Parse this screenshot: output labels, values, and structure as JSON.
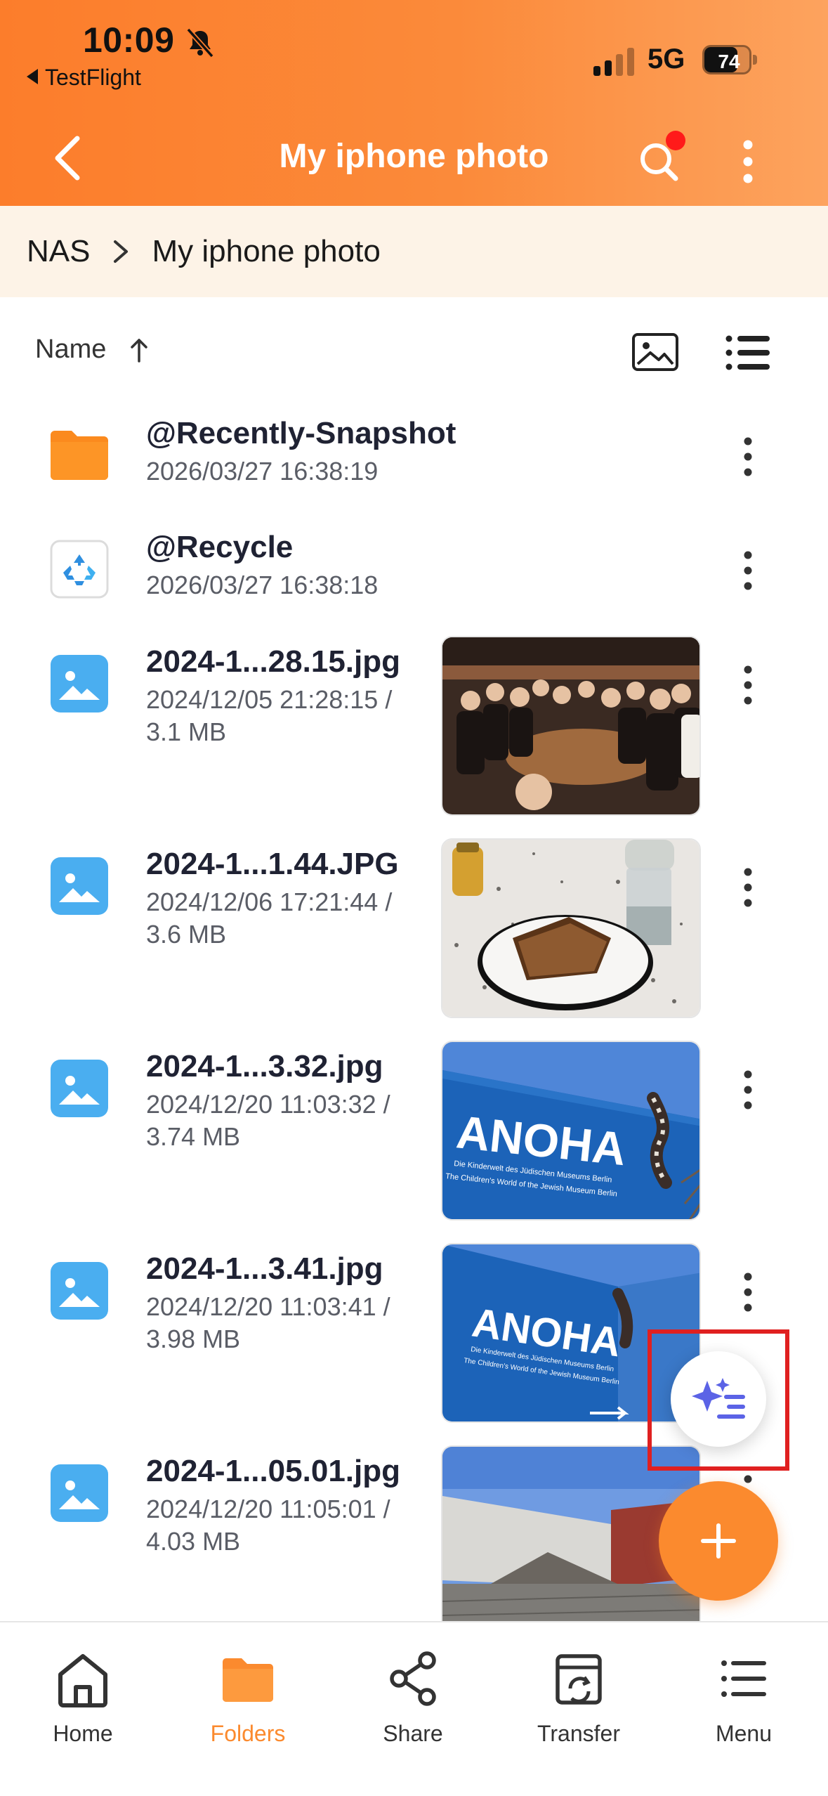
{
  "status_bar": {
    "time": "10:09",
    "back_app": "TestFlight",
    "network": "5G",
    "battery": "74",
    "battery_fraction": 0.74
  },
  "header": {
    "title": "My iphone photo"
  },
  "breadcrumb": {
    "root": "NAS",
    "current": "My iphone photo"
  },
  "sort": {
    "label": "Name",
    "direction": "ascending"
  },
  "files": [
    {
      "name": "@Recently-Snapshot",
      "meta_line1": "2026/03/27 16:38:19",
      "meta_line2": "",
      "icon": "folder-icon"
    },
    {
      "name": "@Recycle",
      "meta_line1": "2026/03/27 16:38:18",
      "meta_line2": "",
      "icon": "recycle-bin-icon"
    },
    {
      "name": "2024-1...28.15.jpg",
      "meta_line1": "2024/12/05 21:28:15 /",
      "meta_line2": "3.1 MB",
      "icon": "image-icon"
    },
    {
      "name": "2024-1...1.44.JPG",
      "meta_line1": "2024/12/06 17:21:44 /",
      "meta_line2": "3.6 MB",
      "icon": "image-icon"
    },
    {
      "name": "2024-1...3.32.jpg",
      "meta_line1": "2024/12/20 11:03:32 /",
      "meta_line2": "3.74 MB",
      "icon": "image-icon"
    },
    {
      "name": "2024-1...3.41.jpg",
      "meta_line1": "2024/12/20 11:03:41 /",
      "meta_line2": "3.98 MB",
      "icon": "image-icon"
    },
    {
      "name": "2024-1...05.01.jpg",
      "meta_line1": "2024/12/20 11:05:01 /",
      "meta_line2": "4.03 MB",
      "icon": "image-icon"
    }
  ],
  "thumbnails": {
    "t1_sign": "ANOHA",
    "t1_line1": "Die Kinderwelt des Jüdischen Museums Berlin",
    "t1_line2": "The Children's World of the Jewish Museum Berlin",
    "t2_sign": "ANOHA",
    "t2_line1": "Die Kinderwelt des Jüdischen Museums Berlin",
    "t2_line2": "The Children's World of the Jewish Museum Berlin"
  },
  "nav": {
    "home": "Home",
    "folders": "Folders",
    "share": "Share",
    "transfer": "Transfer",
    "menu": "Menu",
    "active": "Folders"
  },
  "colors": {
    "accent": "#fb8a2e",
    "header_start": "#fc7d2b",
    "header_end": "#fda35e",
    "breadcrumb_bg": "#fdf3e7",
    "image_icon": "#4aaef0",
    "ai_icon": "#5b63e6",
    "highlight": "#e02020"
  }
}
